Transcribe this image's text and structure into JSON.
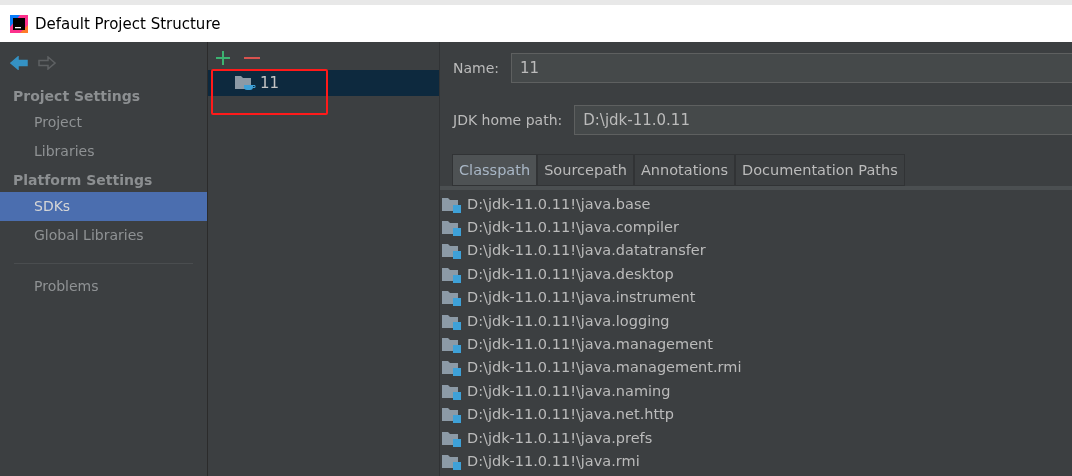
{
  "window": {
    "title": "Default Project Structure"
  },
  "navigation": {
    "back": {
      "disabled": false
    },
    "forward": {
      "disabled": true
    }
  },
  "sidebar": {
    "sections": [
      {
        "title": "Project Settings",
        "items": [
          {
            "label": "Project",
            "selected": false
          },
          {
            "label": "Libraries",
            "selected": false
          }
        ]
      },
      {
        "title": "Platform Settings",
        "items": [
          {
            "label": "SDKs",
            "selected": true
          },
          {
            "label": "Global Libraries",
            "selected": false
          }
        ]
      }
    ],
    "footer_items": [
      {
        "label": "Problems",
        "selected": false
      }
    ]
  },
  "sdk_list": {
    "items": [
      {
        "label": "11",
        "selected": true,
        "highlighted": true
      }
    ]
  },
  "details": {
    "name": {
      "label": "Name:",
      "value": "11"
    },
    "home_path": {
      "label": "JDK home path:",
      "value": "D:\\jdk-11.0.11"
    },
    "tabs": [
      {
        "label": "Classpath",
        "selected": true
      },
      {
        "label": "Sourcepath",
        "selected": false
      },
      {
        "label": "Annotations",
        "selected": false
      },
      {
        "label": "Documentation Paths",
        "selected": false
      }
    ],
    "classpath": [
      "D:\\jdk-11.0.11!\\java.base",
      "D:\\jdk-11.0.11!\\java.compiler",
      "D:\\jdk-11.0.11!\\java.datatransfer",
      "D:\\jdk-11.0.11!\\java.desktop",
      "D:\\jdk-11.0.11!\\java.instrument",
      "D:\\jdk-11.0.11!\\java.logging",
      "D:\\jdk-11.0.11!\\java.management",
      "D:\\jdk-11.0.11!\\java.management.rmi",
      "D:\\jdk-11.0.11!\\java.naming",
      "D:\\jdk-11.0.11!\\java.net.http",
      "D:\\jdk-11.0.11!\\java.prefs",
      "D:\\jdk-11.0.11!\\java.rmi"
    ]
  }
}
